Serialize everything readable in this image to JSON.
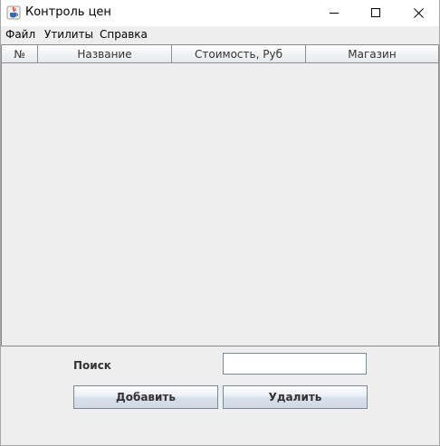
{
  "window": {
    "title": "Контроль цен",
    "icon": "java-cup-icon"
  },
  "menu": {
    "items": [
      {
        "label": "Файл"
      },
      {
        "label": "Утилиты"
      },
      {
        "label": "Справка"
      }
    ]
  },
  "table": {
    "columns": [
      "№",
      "Название",
      "Стоимость, Руб",
      "Магазин"
    ],
    "rows": []
  },
  "search": {
    "label": "Поиск",
    "value": ""
  },
  "buttons": {
    "add_label": "Добавить",
    "delete_label": "Удалить"
  }
}
